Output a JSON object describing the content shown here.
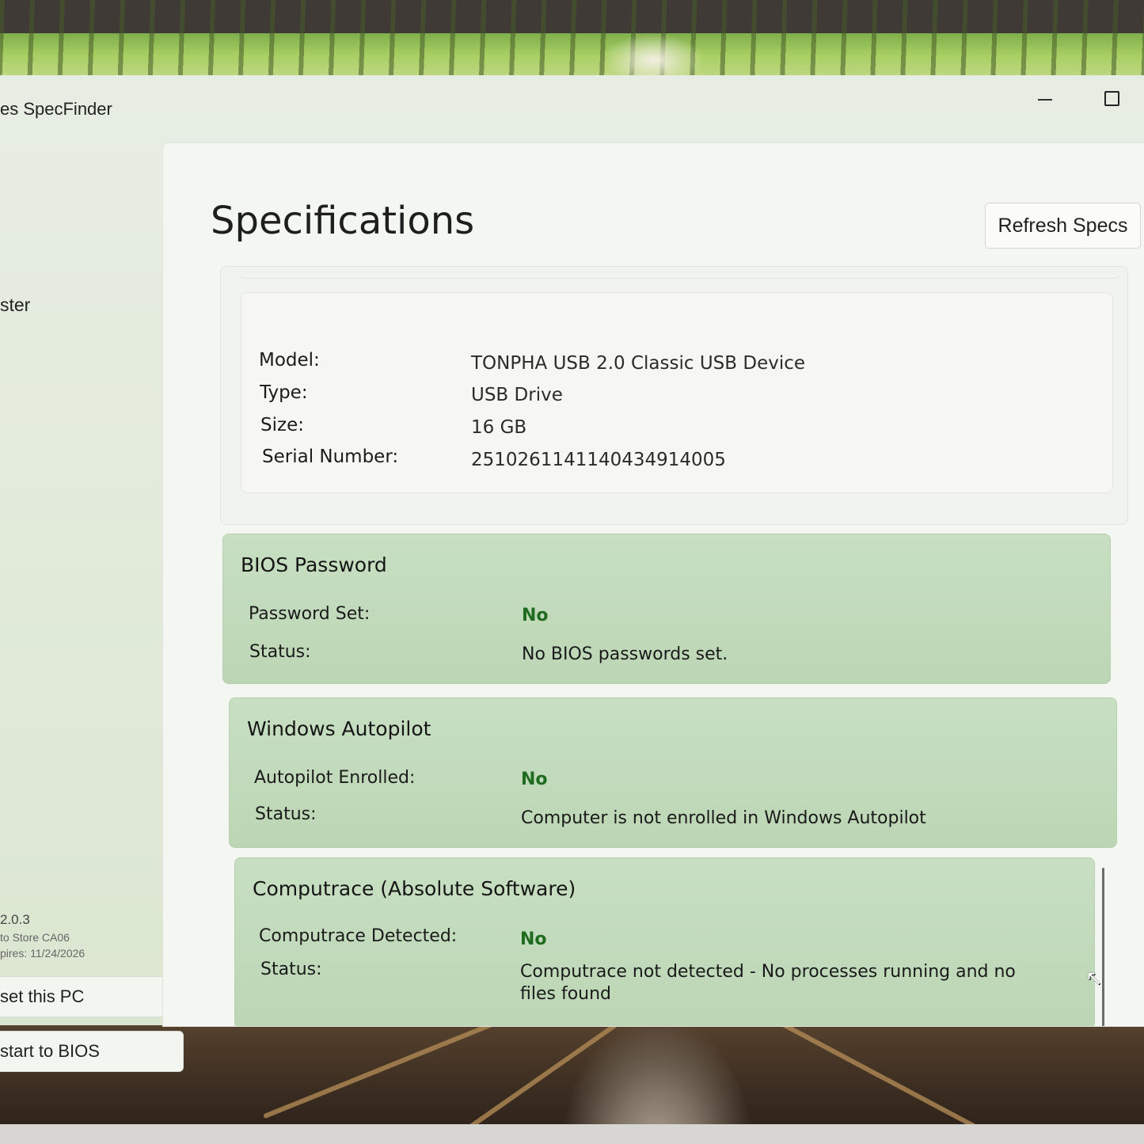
{
  "window": {
    "title": "es SpecFinder"
  },
  "sidebar": {
    "items": [
      {
        "label": "ster"
      }
    ],
    "version": "2.0.3",
    "store": "to Store CA06",
    "expires": "pires: 11/24/2026",
    "buttons": {
      "reset_label": "set this PC",
      "bios_label": "start to BIOS"
    }
  },
  "main": {
    "title": "Specifications",
    "refresh_label": "Refresh Specs",
    "storage": {
      "rows": [
        {
          "label": "Model:",
          "value": "TONPHA USB 2.0 Classic USB Device"
        },
        {
          "label": "Type:",
          "value": "USB Drive"
        },
        {
          "label": "Size:",
          "value": "16 GB"
        },
        {
          "label": "Serial Number:",
          "value": "2510261141140434914005"
        }
      ]
    },
    "bios": {
      "title": "BIOS Password",
      "password_label": "Password Set:",
      "password_value": "No",
      "status_label": "Status:",
      "status_value": "No BIOS passwords set."
    },
    "autopilot": {
      "title": "Windows Autopilot",
      "enrolled_label": "Autopilot Enrolled:",
      "enrolled_value": "No",
      "status_label": "Status:",
      "status_value": "Computer is not enrolled in Windows Autopilot"
    },
    "computrace": {
      "title": "Computrace (Absolute Software)",
      "detected_label": "Computrace Detected:",
      "detected_value": "No",
      "status_label": "Status:",
      "status_value": "Computrace not detected - No processes running and no files found"
    }
  },
  "colors": {
    "section_green": "#c8dfc2",
    "value_green": "#1f6b1f",
    "window_bg": "#e7ede3"
  }
}
